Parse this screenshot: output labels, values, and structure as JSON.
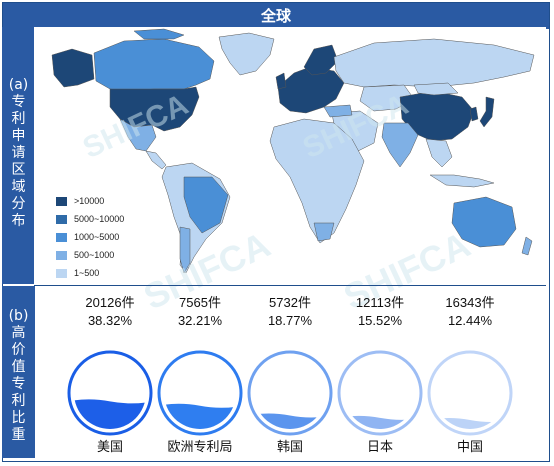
{
  "title": "全球",
  "panel_a_label": "(a)专利申请区域分布",
  "panel_b_label": "(b)高价值专利比重",
  "legend": [
    {
      "label": ">10000",
      "color": "#1d4777"
    },
    {
      "label": "5000~10000",
      "color": "#2f6ba8"
    },
    {
      "label": "1000~5000",
      "color": "#4a8fd6"
    },
    {
      "label": "500~1000",
      "color": "#7fb0e5"
    },
    {
      "label": "1~500",
      "color": "#bcd6f2"
    }
  ],
  "regions": [
    {
      "name": "美国",
      "count": "20126件",
      "share": "38.32%",
      "value": 38.32,
      "color": "#1d5fe8",
      "ring": "#1a5ee6"
    },
    {
      "name": "欧洲专利局",
      "count": "7565件",
      "share": "32.21%",
      "value": 32.21,
      "color": "#2f7ef0",
      "ring": "#2e7cf0"
    },
    {
      "name": "韩国",
      "count": "5732件",
      "share": "18.77%",
      "value": 18.77,
      "color": "#5b95ee",
      "ring": "#6fa1f0"
    },
    {
      "name": "日本",
      "count": "12113件",
      "share": "15.52%",
      "value": 15.52,
      "color": "#8fb4f2",
      "ring": "#9dbdf4"
    },
    {
      "name": "中国",
      "count": "16343件",
      "share": "12.44%",
      "value": 12.44,
      "color": "#bcd3f7",
      "ring": "#c0d5f8"
    }
  ]
}
